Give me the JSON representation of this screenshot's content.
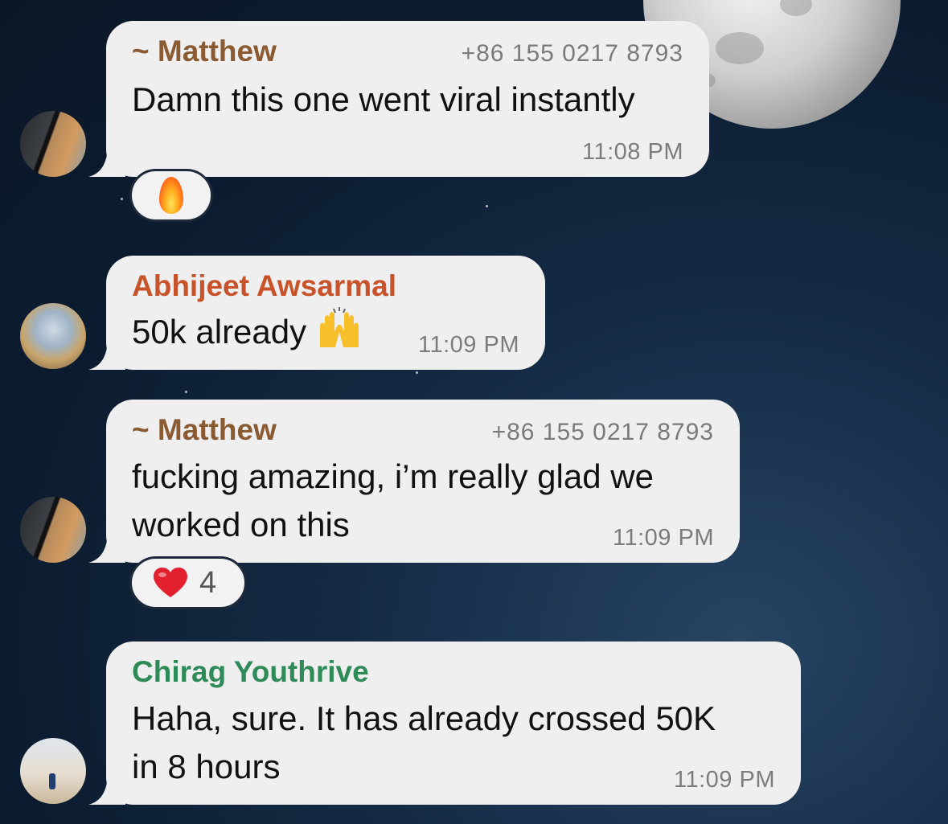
{
  "colors": {
    "matthew": "#8a5a33",
    "abhijeet": "#c8522a",
    "chirag": "#2e8b57",
    "bubble": "#efefef",
    "meta": "#7c7c7c"
  },
  "messages": [
    {
      "sender": "~ Matthew",
      "phone": "+86 155 0217 8793",
      "lines": [
        "Damn this one went viral instantly"
      ],
      "time": "11:08 PM",
      "avatar": "matthew-avatar",
      "reaction": {
        "emoji": "fire-emoji"
      }
    },
    {
      "sender": "Abhijeet Awsarmal",
      "lines": [
        "50k already"
      ],
      "emoji": "raising-hands-emoji",
      "time": "11:09 PM",
      "avatar": "abhijeet-avatar"
    },
    {
      "sender": "~ Matthew",
      "phone": "+86 155 0217 8793",
      "lines": [
        "fucking amazing, i’m really glad we",
        "worked on this"
      ],
      "time": "11:09 PM",
      "avatar": "matthew-avatar",
      "reaction": {
        "emoji": "red-heart-emoji",
        "count": "4"
      }
    },
    {
      "sender": "Chirag Youthrive",
      "lines": [
        "Haha, sure. It has already crossed 50K",
        "in 8 hours"
      ],
      "time": "11:09 PM",
      "avatar": "chirag-avatar"
    }
  ]
}
